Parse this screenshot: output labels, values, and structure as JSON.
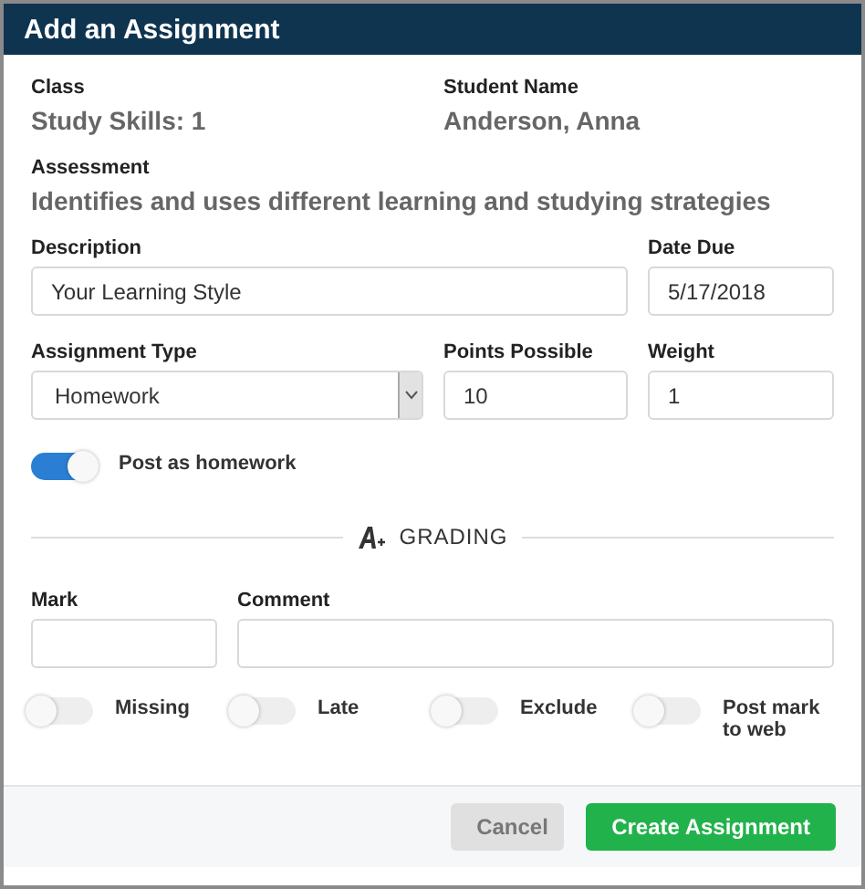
{
  "dialog": {
    "title": "Add an Assignment"
  },
  "info": [
    {
      "label": "Class",
      "value": "Study Skills: 1"
    },
    {
      "label": "Student Name",
      "value": "Anderson, Anna"
    }
  ],
  "assessment": {
    "label": "Assessment",
    "value": "Identifies and uses different learning and studying strategies"
  },
  "description": {
    "label": "Description",
    "value": "Your Learning Style"
  },
  "date_due": {
    "label": "Date Due",
    "value": "5/17/2018"
  },
  "assignment_type": {
    "label": "Assignment Type",
    "value": "Homework"
  },
  "points_possible": {
    "label": "Points Possible",
    "value": "10"
  },
  "weight": {
    "label": "Weight",
    "value": "1"
  },
  "post_as_homework": {
    "label": "Post as homework",
    "on": true
  },
  "grading": {
    "title": "GRADING"
  },
  "mark": {
    "label": "Mark"
  },
  "comment": {
    "label": "Comment"
  },
  "flags": [
    {
      "label": "Missing",
      "on": false
    },
    {
      "label": "Late",
      "on": false
    },
    {
      "label": "Exclude",
      "on": false
    },
    {
      "label": "Post mark to web",
      "on": false
    }
  ],
  "buttons": [
    {
      "label": "Cancel",
      "kind": "secondary"
    },
    {
      "label": "Create Assignment",
      "kind": "primary"
    }
  ]
}
